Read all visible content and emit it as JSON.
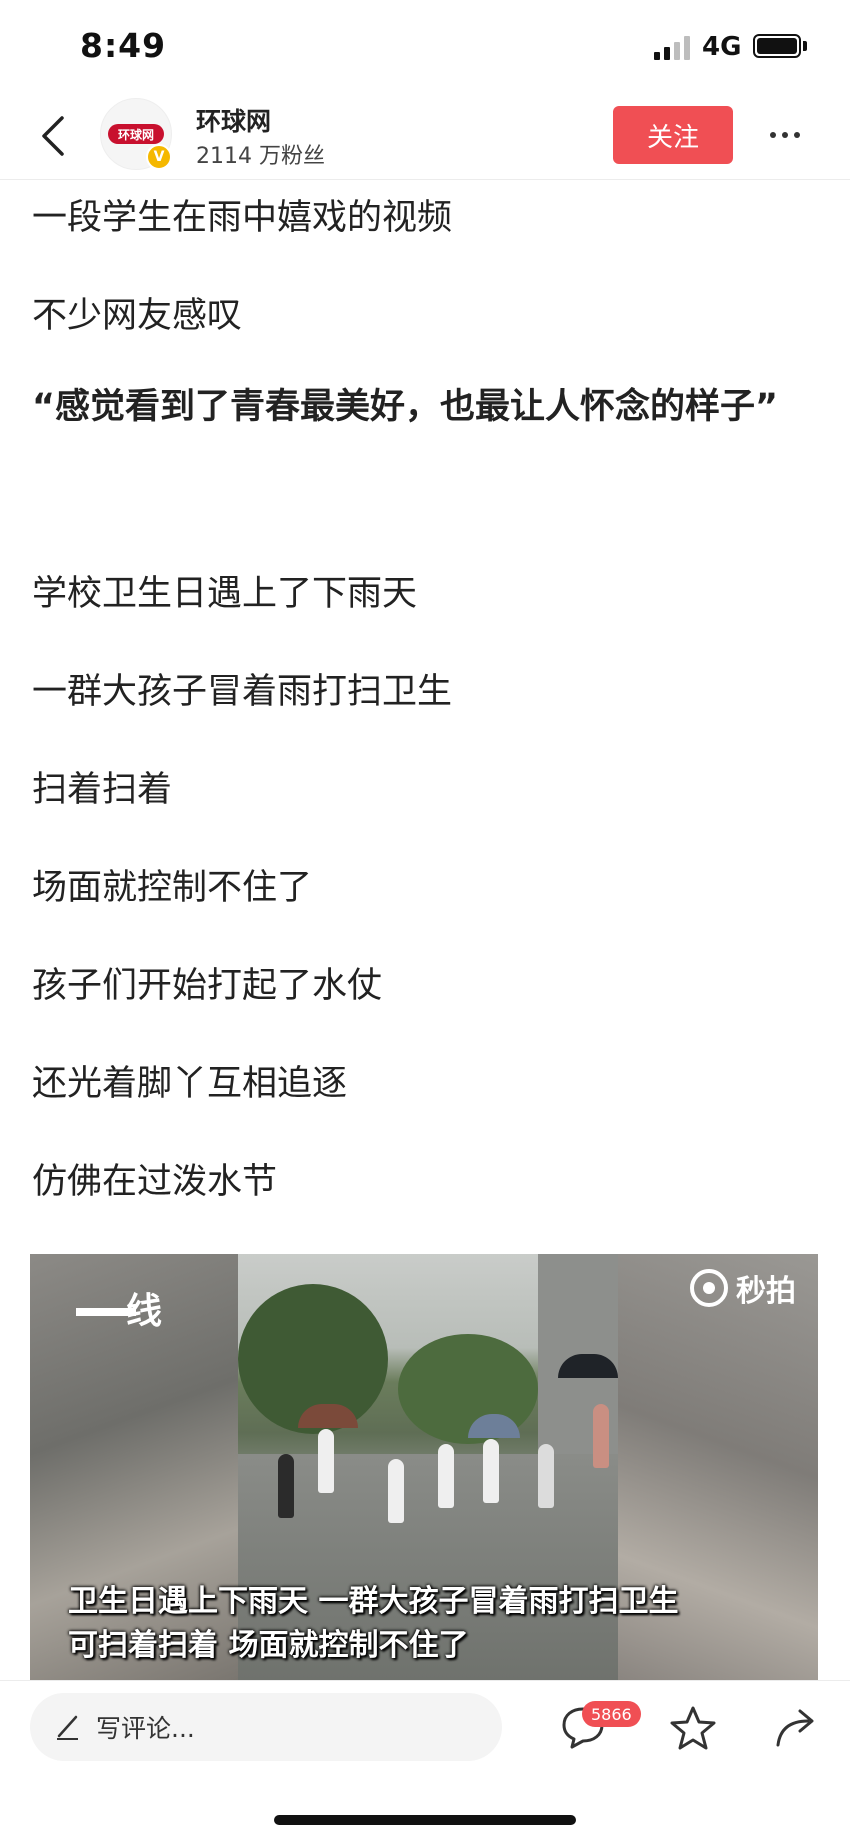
{
  "status_bar": {
    "time": "8:49",
    "network": "4G"
  },
  "header": {
    "account_name": "环球网",
    "avatar_text": "环球网",
    "verified_mark": "V",
    "fans": "2114 万粉丝",
    "follow_label": "关注"
  },
  "article": {
    "paragraphs": [
      "一段学生在雨中嬉戏的视频",
      "不少网友感叹",
      "“感觉看到了青春最美好，也最让人怀念的样子”",
      "学校卫生日遇上了下雨天",
      "一群大孩子冒着雨打扫卫生",
      "扫着扫着",
      "场面就控制不住了",
      "孩子们开始打起了水仗",
      "还光着脚丫互相追逐",
      "仿佛在过泼水节"
    ]
  },
  "video": {
    "logo_left": "线",
    "watermark": "秒拍",
    "subtitle_line1": "卫生日遇上下雨天 一群大孩子冒着雨打扫卫生",
    "subtitle_line2": "可扫着扫着 场面就控制不住了"
  },
  "bottom_bar": {
    "comment_placeholder": "写评论...",
    "comment_count": "5866"
  },
  "colors": {
    "accent": "#f04f54",
    "text": "#222222",
    "verified": "#f5b800",
    "logo_red": "#c8102e"
  },
  "icons": [
    "chevron-left-icon",
    "more-dots-icon",
    "pencil-icon",
    "comment-bubble-icon",
    "star-icon",
    "share-arrow-icon",
    "camera-icon"
  ]
}
